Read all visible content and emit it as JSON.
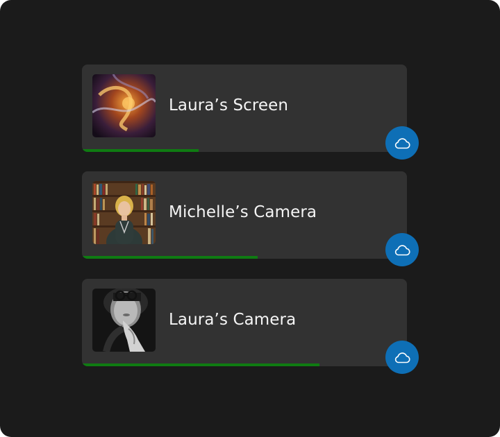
{
  "colors": {
    "panel_bg": "#1b1b1b",
    "card_bg": "#323232",
    "progress": "#0f7b12",
    "upload_button": "#0e6fb6",
    "text": "#f5f5f5"
  },
  "sources": [
    {
      "label": "Laura’s Screen",
      "thumbnail": "abstract-smoke-art",
      "progress": 0.36,
      "action_icon": "cloud-icon"
    },
    {
      "label": "Michelle’s Camera",
      "thumbnail": "woman-in-library-portrait",
      "progress": 0.54,
      "action_icon": "cloud-icon"
    },
    {
      "label": "Laura’s Camera",
      "thumbnail": "black-and-white-portrait",
      "progress": 0.73,
      "action_icon": "cloud-icon"
    }
  ]
}
